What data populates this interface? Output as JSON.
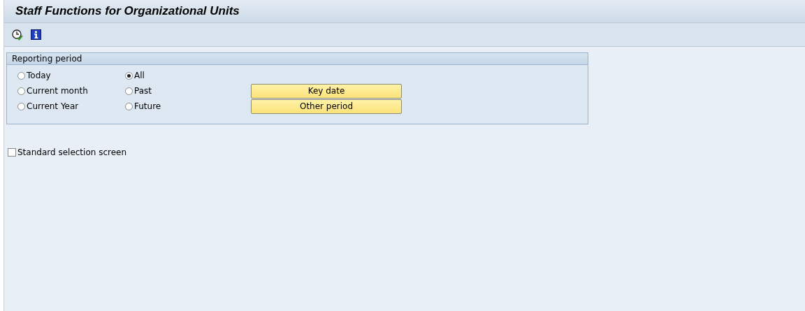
{
  "window": {
    "title": "Staff Functions for Organizational Units"
  },
  "toolbar": {
    "buttons": [
      {
        "kind": "execute"
      },
      {
        "kind": "info"
      }
    ]
  },
  "reporting_period": {
    "title": "Reporting period",
    "options": [
      {
        "label": "Today",
        "selected": false
      },
      {
        "label": "Current month",
        "selected": false
      },
      {
        "label": "Current Year",
        "selected": false
      },
      {
        "label": "All",
        "selected": true
      },
      {
        "label": "Past",
        "selected": false
      },
      {
        "label": "Future",
        "selected": false
      }
    ],
    "buttons": [
      "Key date",
      "Other period"
    ]
  },
  "standard_selection_screen": {
    "label": "Standard selection screen",
    "checked": false
  }
}
